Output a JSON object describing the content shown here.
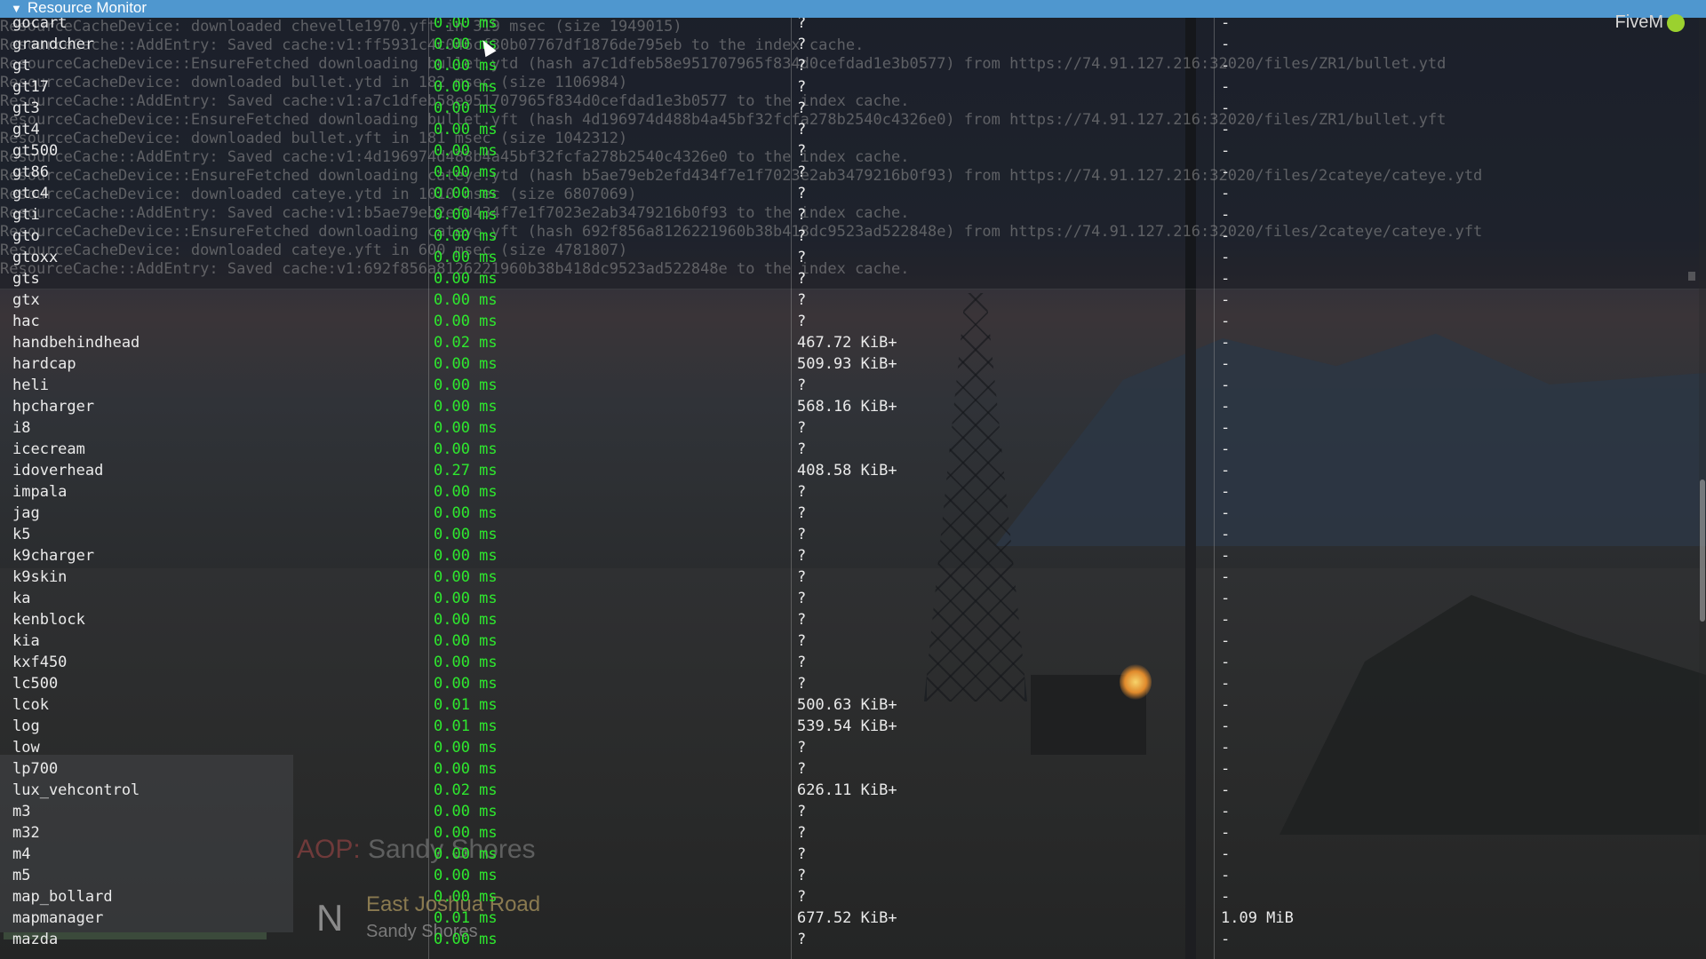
{
  "window": {
    "title": "Resource Monitor",
    "collapse_arrow": "▼"
  },
  "brand": {
    "name": "FiveM"
  },
  "console_lines": [
    "ResourceCacheDevice: downloaded chevelle1970.yft in 319 msec (size 1949015)",
    "ResourceCache::AddEntry: Saved cache:v1:ff5931c4c046cf30b07767df1876de795eb to the index cache.",
    "ResourceCacheDevice::EnsureFetched downloading bullet.ytd (hash a7c1dfeb58e951707965f834d0cefdad1e3b0577) from https://74.91.127.216:32020/files/ZR1/bullet.ytd",
    "ResourceCacheDevice: downloaded bullet.ytd in 182 msec (size 1106984)",
    "ResourceCache::AddEntry: Saved cache:v1:a7c1dfeb58e951707965f834d0cefdad1e3b0577 to the index cache.",
    "ResourceCacheDevice::EnsureFetched downloading bullet.yft (hash 4d196974d488b4a45bf32fcfa278b2540c4326e0) from https://74.91.127.216:32020/files/ZR1/bullet.yft",
    "ResourceCacheDevice: downloaded bullet.yft in 181 msec (size 1042312)",
    "ResourceCache::AddEntry: Saved cache:v1:4d196974d488b4a45bf32fcfa278b2540c4326e0 to the index cache.",
    "ResourceCacheDevice::EnsureFetched downloading cateye.ytd (hash b5ae79eb2efd434f7e1f7023e2ab3479216b0f93) from https://74.91.127.216:32020/files/2cateye/cateye.ytd",
    "ResourceCacheDevice: downloaded cateye.ytd in 1010 msec (size 6807069)",
    "ResourceCache::AddEntry: Saved cache:v1:b5ae79eb2efd434f7e1f7023e2ab3479216b0f93 to the index cache.",
    "ResourceCacheDevice::EnsureFetched downloading cateye.yft (hash 692f856a8126221960b38b418dc9523ad522848e) from https://74.91.127.216:32020/files/2cateye/cateye.yft",
    "ResourceCacheDevice: downloaded cateye.yft in 600 msec (size 4781807)",
    "ResourceCache::AddEntry: Saved cache:v1:692f856a8126221960b38b418dc9523ad522848e to the index cache."
  ],
  "resources": [
    {
      "name": "gocart",
      "cpu": "0.00 ms",
      "memory": "?",
      "streaming": "-"
    },
    {
      "name": "grandcher",
      "cpu": "0.00 ms",
      "memory": "?",
      "streaming": "-"
    },
    {
      "name": "gt",
      "cpu": "0.00 ms",
      "memory": "?",
      "streaming": "-"
    },
    {
      "name": "gt17",
      "cpu": "0.00 ms",
      "memory": "?",
      "streaming": "-"
    },
    {
      "name": "gt3",
      "cpu": "0.00 ms",
      "memory": "?",
      "streaming": "-"
    },
    {
      "name": "gt4",
      "cpu": "0.00 ms",
      "memory": "?",
      "streaming": "-"
    },
    {
      "name": "gt500",
      "cpu": "0.00 ms",
      "memory": "?",
      "streaming": "-"
    },
    {
      "name": "gt86",
      "cpu": "0.00 ms",
      "memory": "?",
      "streaming": "-"
    },
    {
      "name": "gtc4",
      "cpu": "0.00 ms",
      "memory": "?",
      "streaming": "-"
    },
    {
      "name": "gti",
      "cpu": "0.00 ms",
      "memory": "?",
      "streaming": "-"
    },
    {
      "name": "gto",
      "cpu": "0.00 ms",
      "memory": "?",
      "streaming": "-"
    },
    {
      "name": "gtoxx",
      "cpu": "0.00 ms",
      "memory": "?",
      "streaming": "-"
    },
    {
      "name": "gts",
      "cpu": "0.00 ms",
      "memory": "?",
      "streaming": "-"
    },
    {
      "name": "gtx",
      "cpu": "0.00 ms",
      "memory": "?",
      "streaming": "-"
    },
    {
      "name": "hac",
      "cpu": "0.00 ms",
      "memory": "?",
      "streaming": "-"
    },
    {
      "name": "handbehindhead",
      "cpu": "0.02 ms",
      "memory": "467.72 KiB+",
      "streaming": "-"
    },
    {
      "name": "hardcap",
      "cpu": "0.00 ms",
      "memory": "509.93 KiB+",
      "streaming": "-"
    },
    {
      "name": "heli",
      "cpu": "0.00 ms",
      "memory": "?",
      "streaming": "-"
    },
    {
      "name": "hpcharger",
      "cpu": "0.00 ms",
      "memory": "568.16 KiB+",
      "streaming": "-"
    },
    {
      "name": "i8",
      "cpu": "0.00 ms",
      "memory": "?",
      "streaming": "-"
    },
    {
      "name": "icecream",
      "cpu": "0.00 ms",
      "memory": "?",
      "streaming": "-"
    },
    {
      "name": "idoverhead",
      "cpu": "0.27 ms",
      "memory": "408.58 KiB+",
      "streaming": "-"
    },
    {
      "name": "impala",
      "cpu": "0.00 ms",
      "memory": "?",
      "streaming": "-"
    },
    {
      "name": "jag",
      "cpu": "0.00 ms",
      "memory": "?",
      "streaming": "-"
    },
    {
      "name": "k5",
      "cpu": "0.00 ms",
      "memory": "?",
      "streaming": "-"
    },
    {
      "name": "k9charger",
      "cpu": "0.00 ms",
      "memory": "?",
      "streaming": "-"
    },
    {
      "name": "k9skin",
      "cpu": "0.00 ms",
      "memory": "?",
      "streaming": "-"
    },
    {
      "name": "ka",
      "cpu": "0.00 ms",
      "memory": "?",
      "streaming": "-"
    },
    {
      "name": "kenblock",
      "cpu": "0.00 ms",
      "memory": "?",
      "streaming": "-"
    },
    {
      "name": "kia",
      "cpu": "0.00 ms",
      "memory": "?",
      "streaming": "-"
    },
    {
      "name": "kxf450",
      "cpu": "0.00 ms",
      "memory": "?",
      "streaming": "-"
    },
    {
      "name": "lc500",
      "cpu": "0.00 ms",
      "memory": "?",
      "streaming": "-"
    },
    {
      "name": "lcok",
      "cpu": "0.01 ms",
      "memory": "500.63 KiB+",
      "streaming": "-"
    },
    {
      "name": "log",
      "cpu": "0.01 ms",
      "memory": "539.54 KiB+",
      "streaming": "-"
    },
    {
      "name": "low",
      "cpu": "0.00 ms",
      "memory": "?",
      "streaming": "-"
    },
    {
      "name": "lp700",
      "cpu": "0.00 ms",
      "memory": "?",
      "streaming": "-"
    },
    {
      "name": "lux_vehcontrol",
      "cpu": "0.02 ms",
      "memory": "626.11 KiB+",
      "streaming": "-"
    },
    {
      "name": "m3",
      "cpu": "0.00 ms",
      "memory": "?",
      "streaming": "-"
    },
    {
      "name": "m32",
      "cpu": "0.00 ms",
      "memory": "?",
      "streaming": "-"
    },
    {
      "name": "m4",
      "cpu": "0.00 ms",
      "memory": "?",
      "streaming": "-"
    },
    {
      "name": "m5",
      "cpu": "0.00 ms",
      "memory": "?",
      "streaming": "-"
    },
    {
      "name": "map_bollard",
      "cpu": "0.00 ms",
      "memory": "?",
      "streaming": "-"
    },
    {
      "name": "mapmanager",
      "cpu": "0.01 ms",
      "memory": "677.52 KiB+",
      "streaming": "1.09 MiB"
    },
    {
      "name": "mazda",
      "cpu": "0.00 ms",
      "memory": "?",
      "streaming": "-"
    }
  ],
  "hud": {
    "aop_prefix": "AOP:",
    "aop_place": "Sandy Shores",
    "compass": "N",
    "street": "East Joshua Road",
    "area": "Sandy Shores"
  },
  "colors": {
    "titlebar": "#4f97cf",
    "cpu_text": "#2ee82e",
    "text": "#eaeaea",
    "brand_logo": "#9bd12f"
  }
}
